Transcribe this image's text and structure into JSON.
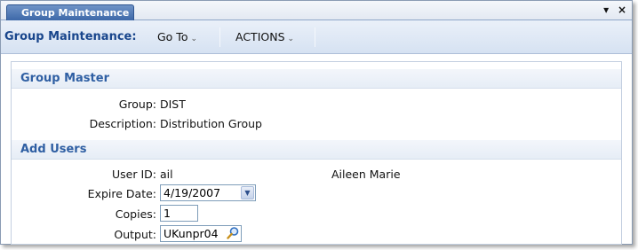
{
  "tab": {
    "title": "Group Maintenance",
    "dropdown_glyph": "▾",
    "close_glyph": "×"
  },
  "toolbar": {
    "title": "Group Maintenance:",
    "menus": [
      {
        "label": "Go To",
        "chevron": "⌄"
      },
      {
        "label": "ACTIONS",
        "chevron": "⌄"
      }
    ]
  },
  "group_master": {
    "heading": "Group Master",
    "group_label": "Group:",
    "group_value": "DIST",
    "description_label": "Description:",
    "description_value": "Distribution Group"
  },
  "add_users": {
    "heading": "Add Users",
    "user_id_label": "User ID:",
    "user_id_value": "ail",
    "user_name": "Aileen Marie",
    "expire_label": "Expire Date:",
    "expire_value": "4/19/2007",
    "copies_label": "Copies:",
    "copies_value": "1",
    "output_label": "Output:",
    "output_value": "UKunpr04"
  },
  "icons": {
    "dropdown": "chevron-down-icon",
    "lookup": "magnifier-icon",
    "close": "close-icon"
  }
}
